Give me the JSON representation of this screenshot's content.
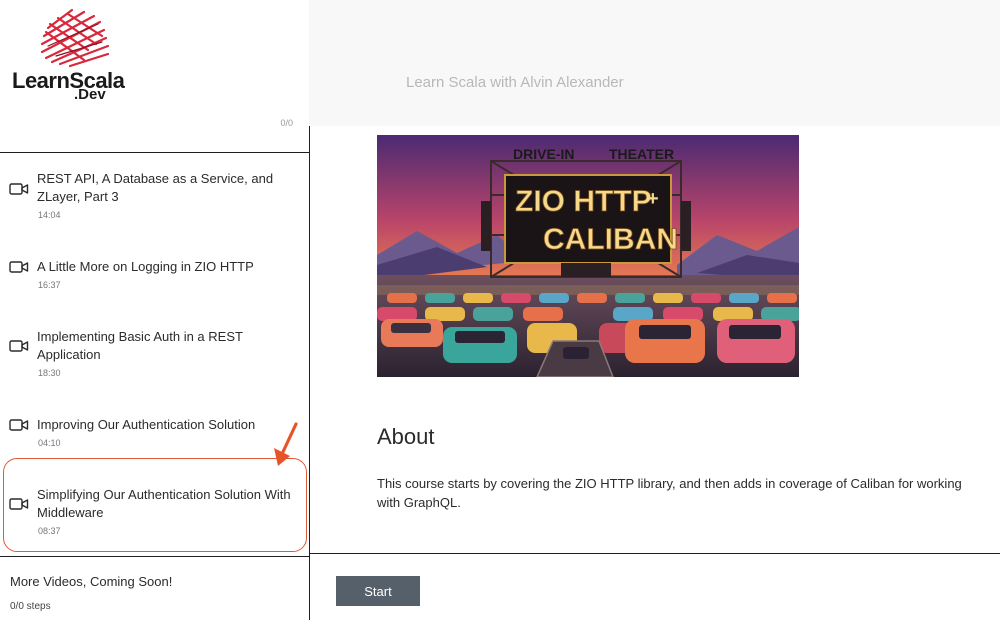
{
  "site": {
    "logo_text": "LearnScala",
    "logo_suffix": ".Dev",
    "tagline": "Learn Scala with Alvin Alexander"
  },
  "sidebar": {
    "partial_count": "0/0",
    "lessons": [
      {
        "title": "REST API, A Database as a Service, and ZLayer, Part 3",
        "duration": "14:04",
        "icon": "video-camera-icon"
      },
      {
        "title": "A Little More on Logging in ZIO HTTP",
        "duration": "16:37",
        "icon": "video-camera-icon"
      },
      {
        "title": "Implementing Basic Auth in a REST Application",
        "duration": "18:30",
        "icon": "video-camera-icon"
      },
      {
        "title": "Improving Our Authentication Solution",
        "duration": "04:10",
        "icon": "video-camera-icon"
      },
      {
        "title": "Simplifying Our Authentication Solution With Middleware",
        "duration": "08:37",
        "icon": "video-camera-icon"
      }
    ],
    "more": {
      "title": "More Videos, Coming Soon!",
      "steps": "0/0 steps"
    }
  },
  "hero": {
    "top_left": "DRIVE-IN",
    "top_right": "THEATER",
    "line1": "ZIO HTTP",
    "plus": "+",
    "line2": "CALIBAN"
  },
  "about": {
    "heading": "About",
    "text": "This course starts by covering the ZIO HTTP library, and then adds in coverage of Caliban for working with GraphQL."
  },
  "actions": {
    "start_label": "Start"
  },
  "colors": {
    "highlight": "#e05a3a",
    "start_button": "#56606b",
    "logo_red": "#d8283c"
  }
}
